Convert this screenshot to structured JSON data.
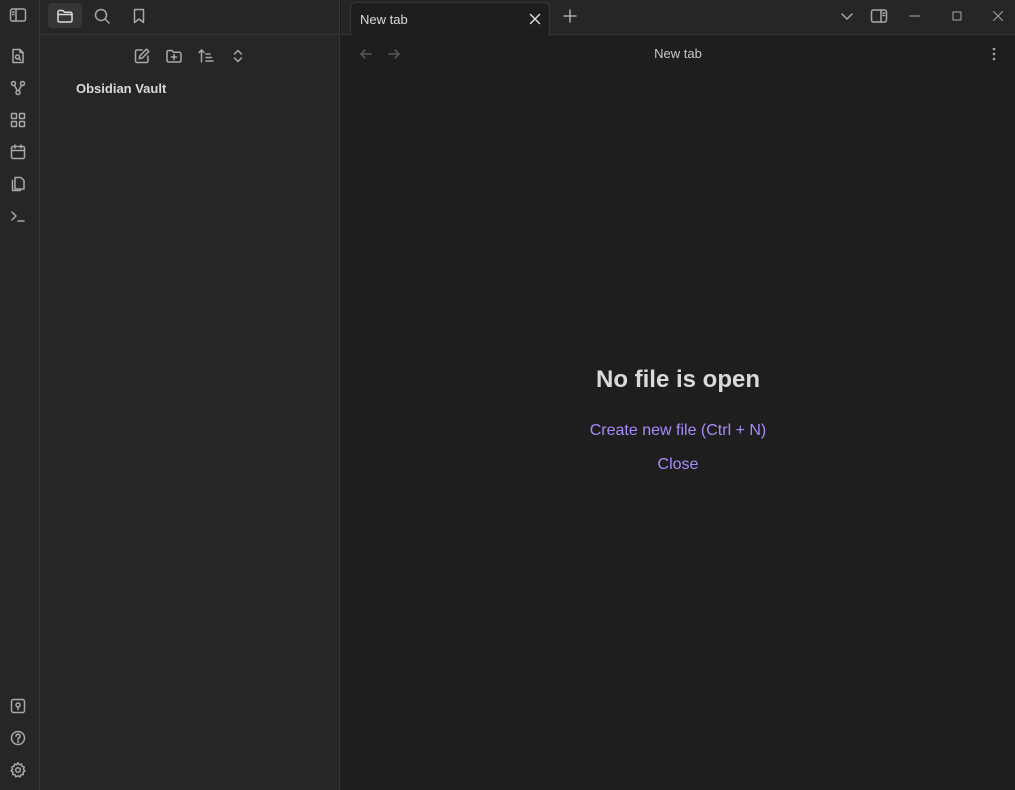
{
  "sidebar": {
    "tabs": [
      {
        "icon": "folder-icon",
        "active": true
      },
      {
        "icon": "search-icon",
        "active": false
      },
      {
        "icon": "bookmark-icon",
        "active": false
      }
    ],
    "nav_buttons": [
      "new-note-icon",
      "new-folder-icon",
      "sort-icon",
      "expand-collapse-icon"
    ],
    "vault_name": "Obsidian Vault"
  },
  "ribbon": {
    "top_icons": [
      "open-quick-switcher-icon",
      "graph-view-icon",
      "canvas-icon",
      "daily-note-icon",
      "templates-icon",
      "command-palette-icon"
    ],
    "bottom_icons": [
      "vault-switcher-icon",
      "help-icon",
      "settings-icon"
    ]
  },
  "tabs": [
    {
      "title": "New tab",
      "active": true
    }
  ],
  "view": {
    "title": "New tab"
  },
  "empty_state": {
    "title": "No file is open",
    "create_label": "Create new file (Ctrl + N)",
    "close_label": "Close"
  },
  "colors": {
    "accent": "#a88bfa",
    "background": "#1e1e1e",
    "sidebar": "#262626",
    "border": "#363636",
    "text": "#dadada"
  }
}
